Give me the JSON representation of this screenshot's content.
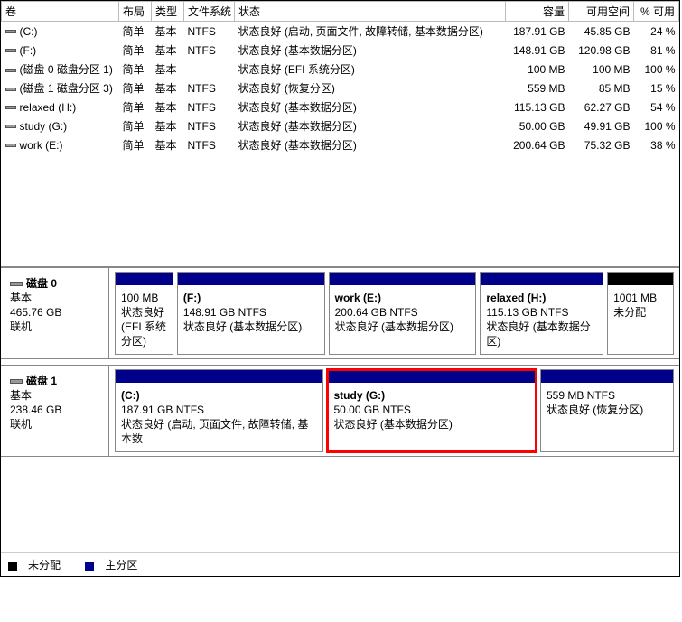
{
  "columns": {
    "volume": "卷",
    "layout": "布局",
    "type": "类型",
    "fs": "文件系统",
    "status": "状态",
    "capacity": "容量",
    "free": "可用空间",
    "pct": "% 可用"
  },
  "volumes": [
    {
      "name": "(C:)",
      "layout": "简单",
      "type": "基本",
      "fs": "NTFS",
      "status": "状态良好 (启动, 页面文件, 故障转储, 基本数据分区)",
      "capacity": "187.91 GB",
      "free": "45.85 GB",
      "pct": "24 %"
    },
    {
      "name": "(F:)",
      "layout": "简单",
      "type": "基本",
      "fs": "NTFS",
      "status": "状态良好 (基本数据分区)",
      "capacity": "148.91 GB",
      "free": "120.98 GB",
      "pct": "81 %"
    },
    {
      "name": "(磁盘 0 磁盘分区 1)",
      "layout": "简单",
      "type": "基本",
      "fs": "",
      "status": "状态良好 (EFI 系统分区)",
      "capacity": "100 MB",
      "free": "100 MB",
      "pct": "100 %"
    },
    {
      "name": "(磁盘 1 磁盘分区 3)",
      "layout": "简单",
      "type": "基本",
      "fs": "NTFS",
      "status": "状态良好 (恢复分区)",
      "capacity": "559 MB",
      "free": "85 MB",
      "pct": "15 %"
    },
    {
      "name": "relaxed (H:)",
      "layout": "简单",
      "type": "基本",
      "fs": "NTFS",
      "status": "状态良好 (基本数据分区)",
      "capacity": "115.13 GB",
      "free": "62.27 GB",
      "pct": "54 %"
    },
    {
      "name": "study (G:)",
      "layout": "简单",
      "type": "基本",
      "fs": "NTFS",
      "status": "状态良好 (基本数据分区)",
      "capacity": "50.00 GB",
      "free": "49.91 GB",
      "pct": "100 %"
    },
    {
      "name": "work (E:)",
      "layout": "简单",
      "type": "基本",
      "fs": "NTFS",
      "status": "状态良好 (基本数据分区)",
      "capacity": "200.64 GB",
      "free": "75.32 GB",
      "pct": "38 %"
    }
  ],
  "disks": [
    {
      "name": "磁盘 0",
      "type": "基本",
      "size": "465.76 GB",
      "state": "联机",
      "partitions": [
        {
          "label": "",
          "line2": "100 MB",
          "line3": "状态良好 (EFI 系统分区)",
          "kind": "primary",
          "highlight": false,
          "flex": 0.7
        },
        {
          "label": "(F:)",
          "line2": "148.91 GB NTFS",
          "line3": "状态良好 (基本数据分区)",
          "kind": "primary",
          "highlight": false,
          "flex": 1.8
        },
        {
          "label": "work  (E:)",
          "line2": "200.64 GB NTFS",
          "line3": "状态良好 (基本数据分区)",
          "kind": "primary",
          "highlight": false,
          "flex": 1.8
        },
        {
          "label": "relaxed  (H:)",
          "line2": "115.13 GB NTFS",
          "line3": "状态良好 (基本数据分区)",
          "kind": "primary",
          "highlight": false,
          "flex": 1.5
        },
        {
          "label": "",
          "line2": "1001 MB",
          "line3": "未分配",
          "kind": "unalloc",
          "highlight": false,
          "flex": 0.8
        }
      ]
    },
    {
      "name": "磁盘 1",
      "type": "基本",
      "size": "238.46 GB",
      "state": "联机",
      "partitions": [
        {
          "label": "(C:)",
          "line2": "187.91 GB NTFS",
          "line3": "状态良好 (启动, 页面文件, 故障转储, 基本数",
          "kind": "primary",
          "highlight": false,
          "flex": 2.2
        },
        {
          "label": "study  (G:)",
          "line2": "50.00 GB NTFS",
          "line3": "状态良好 (基本数据分区)",
          "kind": "primary",
          "highlight": true,
          "flex": 2.2
        },
        {
          "label": "",
          "line2": "559 MB NTFS",
          "line3": "状态良好 (恢复分区)",
          "kind": "primary",
          "highlight": false,
          "flex": 1.4
        }
      ]
    }
  ],
  "legend": {
    "unallocated": "未分配",
    "primary": "主分区"
  }
}
